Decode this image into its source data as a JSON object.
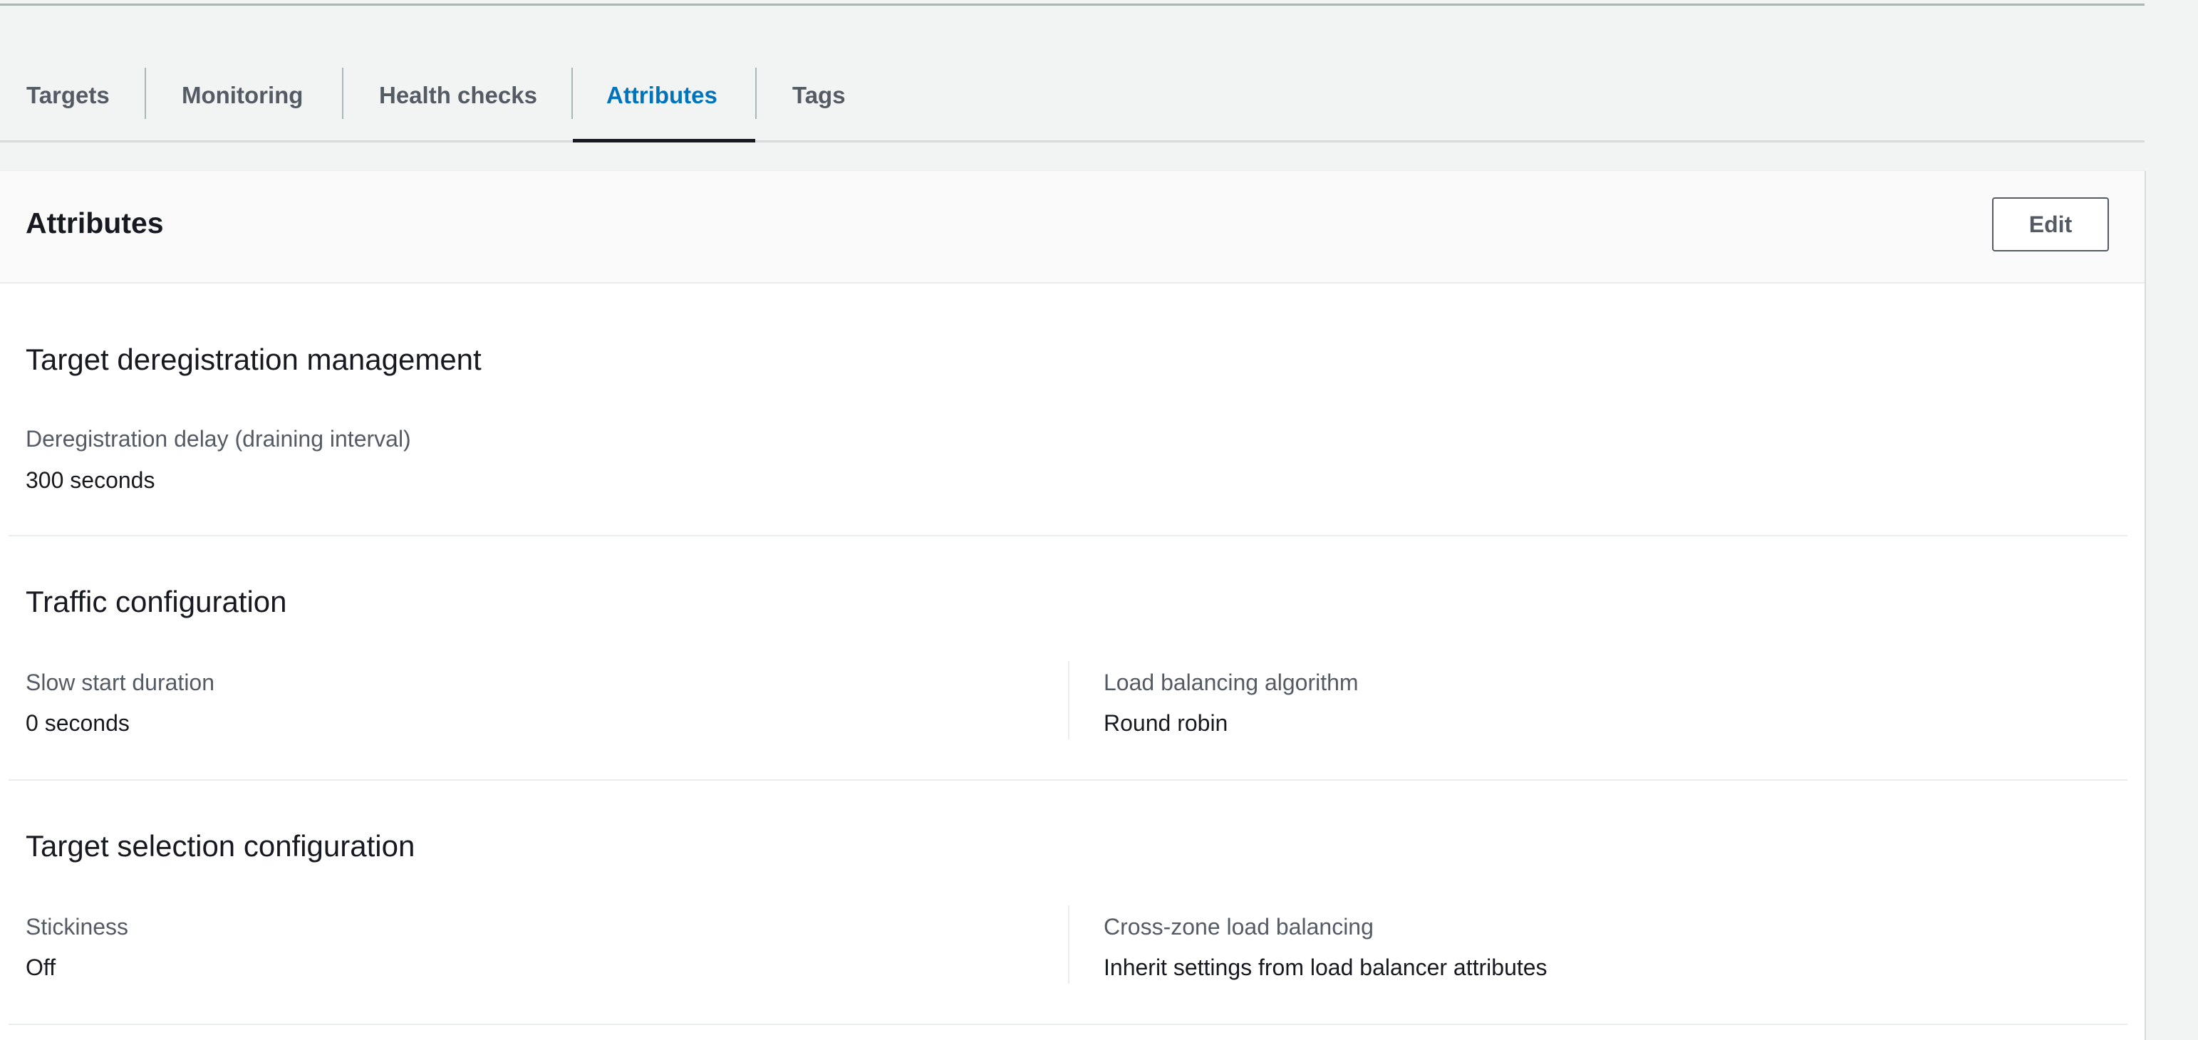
{
  "tabs": [
    {
      "label": "Targets",
      "active": false
    },
    {
      "label": "Monitoring",
      "active": false
    },
    {
      "label": "Health checks",
      "active": false
    },
    {
      "label": "Attributes",
      "active": true
    },
    {
      "label": "Tags",
      "active": false
    }
  ],
  "panel": {
    "title": "Attributes",
    "edit_label": "Edit"
  },
  "sections": {
    "deregistration": {
      "title": "Target deregistration management",
      "delay_label": "Deregistration delay (draining interval)",
      "delay_value": "300 seconds"
    },
    "traffic": {
      "title": "Traffic configuration",
      "slow_start_label": "Slow start duration",
      "slow_start_value": "0 seconds",
      "algorithm_label": "Load balancing algorithm",
      "algorithm_value": "Round robin"
    },
    "selection": {
      "title": "Target selection configuration",
      "stickiness_label": "Stickiness",
      "stickiness_value": "Off",
      "cross_zone_label": "Cross-zone load balancing",
      "cross_zone_value": "Inherit settings from load balancer attributes"
    }
  },
  "colors": {
    "active_tab": "#0073bb",
    "active_tab_underline": "#16191f",
    "muted_text": "#545b64",
    "page_background": "#f2f3f3"
  }
}
